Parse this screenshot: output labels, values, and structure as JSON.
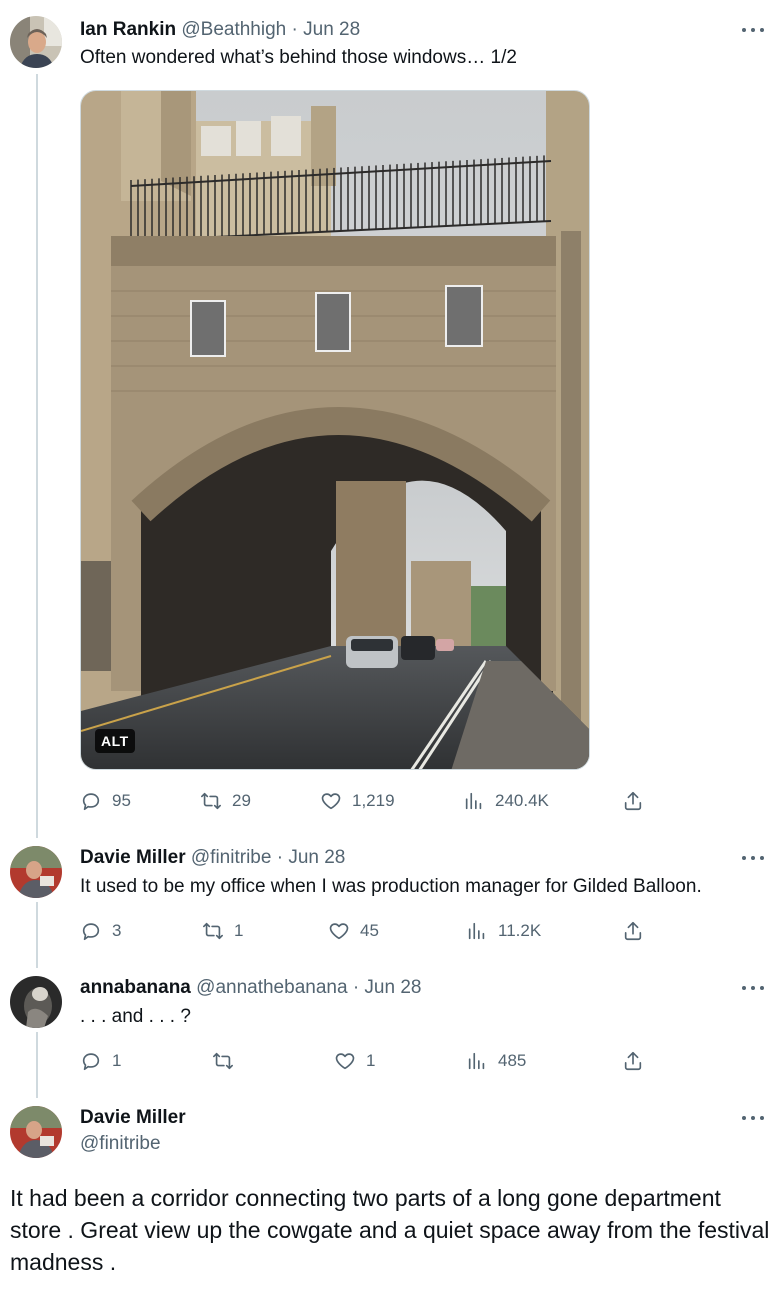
{
  "tweets": [
    {
      "name": "Ian Rankin",
      "handle": "@Beathhigh",
      "date": "· Jun 28",
      "text": "Often wondered what’s behind those windows… 1/2",
      "alt_label": "ALT",
      "stats": {
        "replies": "95",
        "retweets": "29",
        "likes": "1,219",
        "views": "240.4K"
      }
    },
    {
      "name": "Davie Miller",
      "handle": "@finitribe",
      "date": "· Jun 28",
      "text": "It used to be my office when I was production manager for Gilded Balloon.",
      "stats": {
        "replies": "3",
        "retweets": "1",
        "likes": "45",
        "views": "11.2K"
      }
    },
    {
      "name": "annabanana",
      "handle": "@annathebanana",
      "date": "· Jun 28",
      "text": ". . . and . . . ?",
      "stats": {
        "replies": "1",
        "retweets": "",
        "likes": "1",
        "views": "485"
      }
    }
  ],
  "main_tweet": {
    "name": "Davie Miller",
    "handle": "@finitribe",
    "text": "It had been a corridor connecting two parts of a long gone department store . Great view up the cowgate and a quiet space away from the festival madness ."
  },
  "icons": [
    "more-icon",
    "reply-icon",
    "retweet-icon",
    "like-icon",
    "views-icon",
    "share-icon"
  ],
  "colors": {
    "text": "#0f1419",
    "secondary": "#536471",
    "thread_line": "#cfd9de"
  }
}
